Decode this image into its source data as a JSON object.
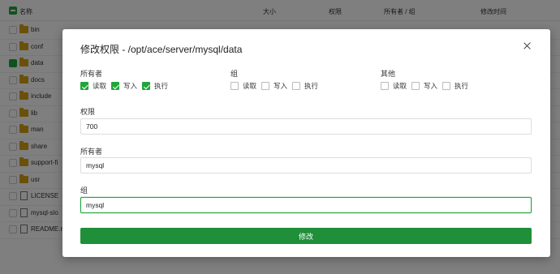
{
  "table": {
    "headers": {
      "name": "名称",
      "size": "大小",
      "perm": "权限",
      "owner": "所有者 / 组",
      "mtime": "修改时间"
    },
    "rows": [
      {
        "name": "bin",
        "type": "folder",
        "checked": false
      },
      {
        "name": "conf",
        "type": "folder",
        "checked": false
      },
      {
        "name": "data",
        "type": "folder",
        "checked": true
      },
      {
        "name": "docs",
        "type": "folder",
        "checked": false
      },
      {
        "name": "include",
        "type": "folder",
        "checked": false
      },
      {
        "name": "lib",
        "type": "folder",
        "checked": false
      },
      {
        "name": "man",
        "type": "folder",
        "checked": false
      },
      {
        "name": "share",
        "type": "folder",
        "checked": false
      },
      {
        "name": "support-fi",
        "type": "folder",
        "checked": false
      },
      {
        "name": "usr",
        "type": "folder",
        "checked": false
      },
      {
        "name": "LICENSE",
        "type": "file",
        "checked": false
      },
      {
        "name": "mysql-slo",
        "type": "file",
        "checked": false
      },
      {
        "name": "README.r",
        "type": "file",
        "checked": false
      }
    ]
  },
  "modal": {
    "title": "修改权限 - /opt/ace/server/mysql/data",
    "groups": [
      {
        "title": "所有者",
        "read": "读取",
        "write": "写入",
        "exec": "执行",
        "read_on": true,
        "write_on": true,
        "exec_on": true
      },
      {
        "title": "组",
        "read": "读取",
        "write": "写入",
        "exec": "执行",
        "read_on": false,
        "write_on": false,
        "exec_on": false
      },
      {
        "title": "其他",
        "read": "读取",
        "write": "写入",
        "exec": "执行",
        "read_on": false,
        "write_on": false,
        "exec_on": false
      }
    ],
    "perm_label": "权限",
    "perm_value": "700",
    "owner_label": "所有者",
    "owner_value": "mysql",
    "group_label": "组",
    "group_value": "mysql",
    "submit_label": "修改"
  },
  "colors": {
    "accent": "#20a53a",
    "button": "#1f8f3a",
    "folder": "#d4a017"
  }
}
